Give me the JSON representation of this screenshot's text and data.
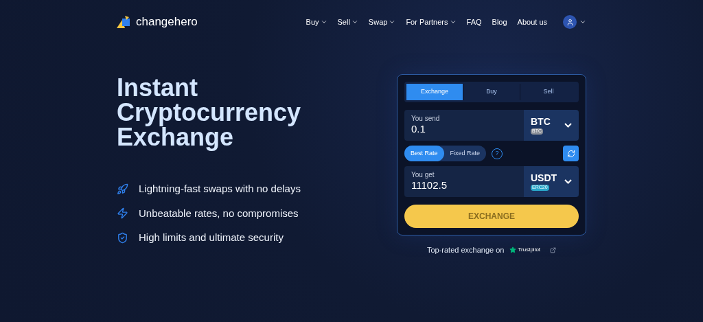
{
  "header": {
    "logo": "changehero",
    "nav": [
      {
        "label": "Buy",
        "dropdown": true
      },
      {
        "label": "Sell",
        "dropdown": true
      },
      {
        "label": "Swap",
        "dropdown": true
      },
      {
        "label": "For Partners",
        "dropdown": true
      },
      {
        "label": "FAQ",
        "dropdown": false
      },
      {
        "label": "Blog",
        "dropdown": false
      },
      {
        "label": "About us",
        "dropdown": false
      }
    ]
  },
  "hero": {
    "title_lines": [
      "Instant",
      "Cryptocurrency",
      "Exchange"
    ],
    "features": [
      {
        "kind": "rocket",
        "text": "Lightning-fast swaps with no delays"
      },
      {
        "kind": "bolt",
        "text": "Unbeatable rates, no compromises"
      },
      {
        "kind": "shield",
        "text": "High limits and ultimate security"
      }
    ]
  },
  "widget": {
    "tabs": [
      {
        "label": "Exchange",
        "selected": true
      },
      {
        "label": "Buy",
        "selected": false
      },
      {
        "label": "Sell",
        "selected": false
      }
    ],
    "send": {
      "label": "You send",
      "value": "0.1",
      "currency": "BTC",
      "network": "BTC",
      "color": "#8a8f98"
    },
    "rates": [
      {
        "label": "Best Rate",
        "selected": true
      },
      {
        "label": "Fixed Rate",
        "selected": false
      }
    ],
    "help": "?",
    "get": {
      "label": "You get",
      "value": "11102.5",
      "currency": "USDT",
      "network": "ERC20",
      "color": "#2aa7c9"
    },
    "button": "EXCHANGE"
  },
  "trust": {
    "text": "Top-rated exchange on",
    "brand": "Trustpilot"
  }
}
